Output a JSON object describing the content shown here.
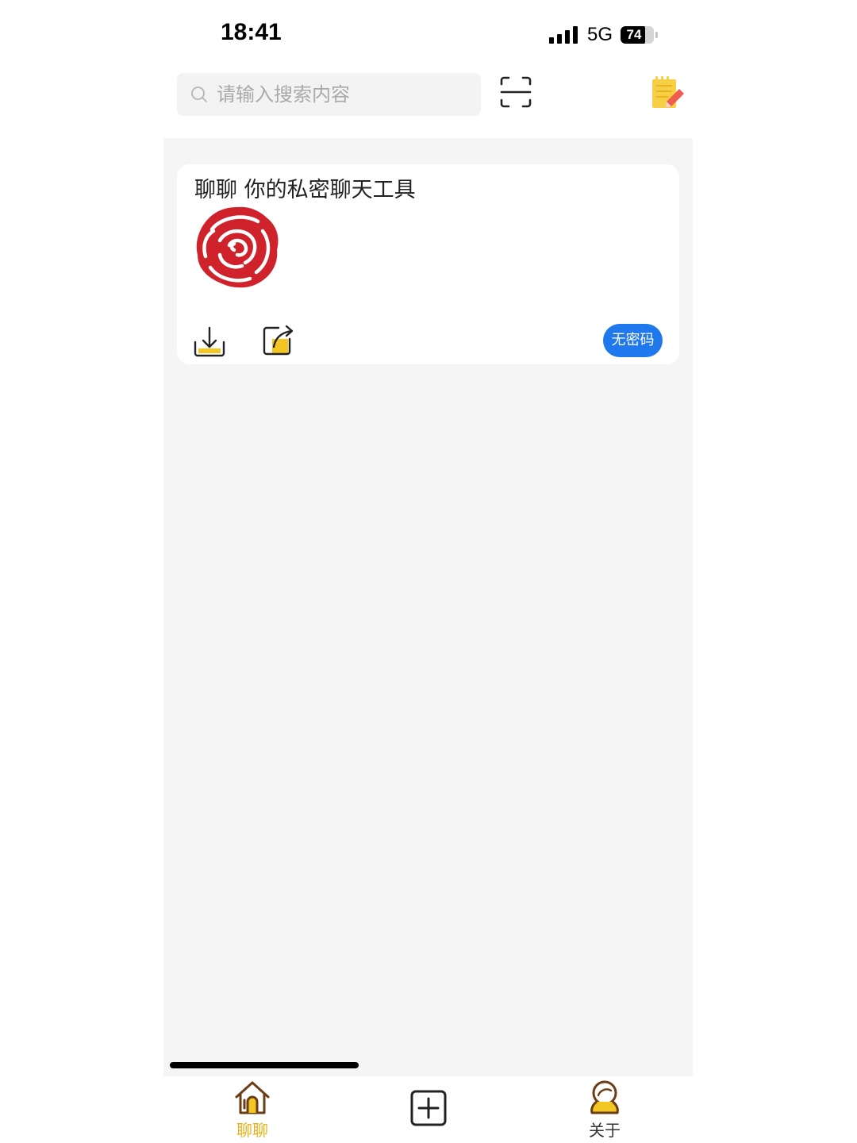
{
  "status_bar": {
    "time": "18:41",
    "network": "5G",
    "battery_level": "74",
    "battery_fraction": 0.74
  },
  "search": {
    "placeholder": "请输入搜索内容",
    "value": ""
  },
  "toolbar": {
    "scan_icon": "scan-icon",
    "note_icon": "note-edit-icon"
  },
  "card": {
    "title": "聊聊 你的私密聊天工具",
    "image_icon": "rose-icon",
    "download_icon": "download-icon",
    "edit_icon": "edit-share-icon",
    "badge": "无密码"
  },
  "tabbar": {
    "home_label": "聊聊",
    "about_label": "关于",
    "add_icon": "plus-box-icon"
  },
  "colors": {
    "accent_yellow": "#e6b21a",
    "badge_blue": "#1f78ec",
    "rose_red": "#d0222a",
    "background": "#f5f5f5"
  }
}
